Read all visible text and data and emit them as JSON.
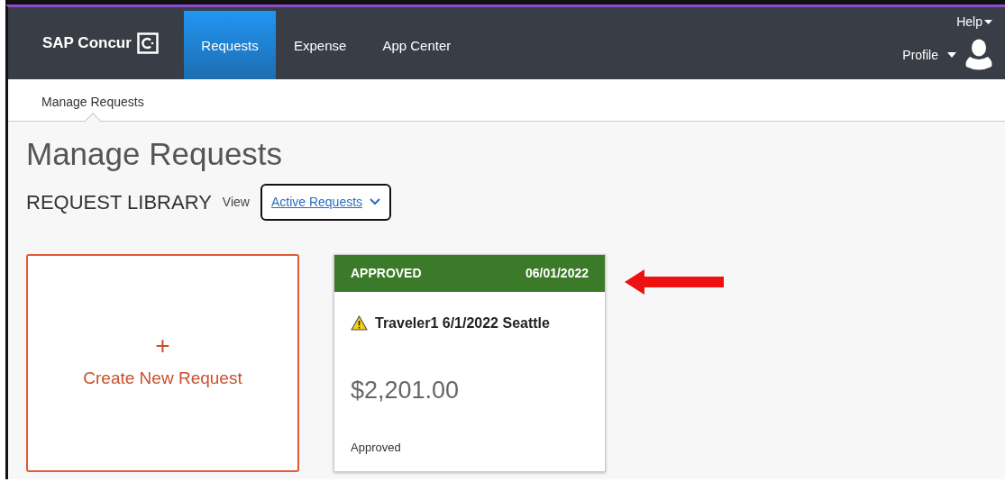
{
  "brand": {
    "name": "SAP Concur"
  },
  "nav_tabs": [
    {
      "label": "Requests",
      "selected": true
    },
    {
      "label": "Expense",
      "selected": false
    },
    {
      "label": "App Center",
      "selected": false
    }
  ],
  "help_menu": {
    "label": "Help"
  },
  "profile_menu": {
    "label": "Profile"
  },
  "subnav": [
    {
      "label": "Manage Requests",
      "selected": true
    }
  ],
  "page_title": "Manage Requests",
  "library": {
    "title": "REQUEST LIBRARY",
    "view_label": "View",
    "view_value": "Active Requests"
  },
  "create_card": {
    "icon": "+",
    "label": "Create New Request"
  },
  "request_cards": [
    {
      "status": "APPROVED",
      "date": "06/01/2022",
      "warning": true,
      "name": "Traveler1 6/1/2022 Seattle",
      "amount": "$2,201.00",
      "footer": "Approved"
    }
  ]
}
